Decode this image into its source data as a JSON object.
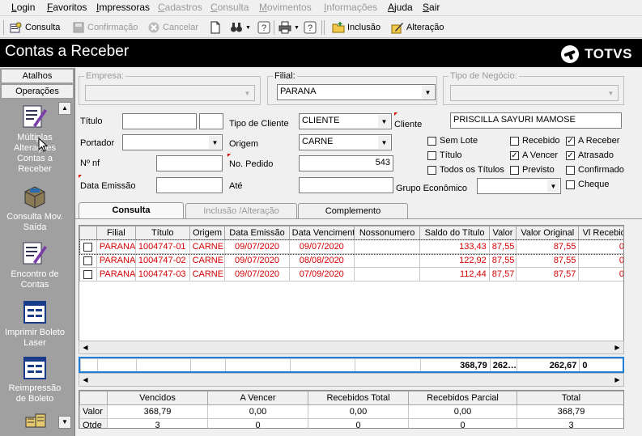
{
  "menu": {
    "items": [
      {
        "label": "Login"
      },
      {
        "label": "Favoritos"
      },
      {
        "label": "Impressoras"
      },
      {
        "label": "Cadastros"
      },
      {
        "label": "Consulta"
      },
      {
        "label": "Movimentos"
      },
      {
        "label": "Informações"
      },
      {
        "label": "Ajuda"
      },
      {
        "label": "Sair"
      }
    ]
  },
  "toolbar": {
    "consulta": "Consulta",
    "confirmacao": "Confirmação",
    "cancelar": "Cancelar",
    "inclusao": "Inclusão",
    "alteracao": "Alteração"
  },
  "header": {
    "title": "Contas a Receber",
    "brand": "TOTVS"
  },
  "sidebar": {
    "atalhos": "Atalhos",
    "operacoes": "Operações",
    "items": [
      {
        "label": "Múltiplas Alterações Contas a Receber",
        "icon": "document-pen-icon"
      },
      {
        "label": "Consulta Mov. Saída",
        "icon": "box-icon"
      },
      {
        "label": "Encontro de Contas",
        "icon": "document-pen-icon"
      },
      {
        "label": "Imprimir Boleto Laser",
        "icon": "form-icon"
      },
      {
        "label": "Reimpressão de Boleto",
        "icon": "form-icon"
      }
    ]
  },
  "form": {
    "empresa_label": "Empresa:",
    "empresa_value": "",
    "filial_label": "Filial:",
    "filial_value": "PARANA",
    "tipo_negocio_label": "Tipo de Negócio:",
    "tipo_negocio_value": "",
    "titulo_label": "Título",
    "titulo_value": "",
    "titulo_seq_value": "",
    "tipo_cliente_label": "Tipo de Cliente",
    "tipo_cliente_value": "CLIENTE",
    "cliente_label": "Cliente",
    "cliente_value": "PRISCILLA SAYURI MAMOSE",
    "portador_label": "Portador",
    "portador_value": "",
    "origem_label": "Origem",
    "origem_value": "CARNE",
    "nf_label": "Nº nf",
    "nf_value": "",
    "pedido_label": "No. Pedido",
    "pedido_value": "543",
    "data_emissao_label": "Data Emissão",
    "data_emissao_value": "",
    "ate_label": "Até",
    "ate_value": "",
    "grupo_label": "Grupo Econômico",
    "grupo_value": ""
  },
  "checkboxes": [
    {
      "label": "Sem Lote",
      "checked": false
    },
    {
      "label": "Título",
      "checked": false
    },
    {
      "label": "Todos os Títulos",
      "checked": false
    },
    {
      "label": "Recebido",
      "checked": false
    },
    {
      "label": "A Vencer",
      "checked": true
    },
    {
      "label": "Previsto",
      "checked": false
    },
    {
      "label": "A Receber",
      "checked": true
    },
    {
      "label": "Atrasado",
      "checked": true
    },
    {
      "label": "Confirmado",
      "checked": false
    },
    {
      "label": "Cheque",
      "checked": false
    }
  ],
  "tabs": [
    {
      "label": "Consulta"
    },
    {
      "label": "Inclusão /Alteração"
    },
    {
      "label": "Complemento"
    }
  ],
  "grid": {
    "columns": [
      "Filial",
      "Título",
      "Origem",
      "Data Emissão",
      "Data Vencimento",
      "Nossonumero",
      "Saldo do Título",
      "Valor",
      "Valor Original",
      "Vl Recebid"
    ],
    "rows": [
      [
        "PARANA",
        "1004747-01",
        "CARNE",
        "09/07/2020",
        "09/07/2020",
        "",
        "133,43",
        "87,55",
        "87,55",
        "0,"
      ],
      [
        "PARANA",
        "1004747-02",
        "CARNE",
        "09/07/2020",
        "08/08/2020",
        "",
        "122,92",
        "87,55",
        "87,55",
        "0,"
      ],
      [
        "PARANA",
        "1004747-03",
        "CARNE",
        "09/07/2020",
        "07/09/2020",
        "",
        "112,44",
        "87,57",
        "87,57",
        "0,"
      ]
    ],
    "totals": {
      "saldo": "368,79",
      "valor": "262…",
      "valor_original": "262,67",
      "vl_recebido": "0"
    }
  },
  "summary": {
    "headers": [
      "Vencidos",
      "A Vencer",
      "Recebidos Total",
      "Recebidos Parcial",
      "Total"
    ],
    "rows": [
      {
        "label": "Valor",
        "values": [
          "368,79",
          "0,00",
          "0,00",
          "0,00",
          "368,79"
        ]
      },
      {
        "label": "Qtde",
        "values": [
          "3",
          "0",
          "0",
          "0",
          "3"
        ]
      }
    ]
  },
  "colors": {
    "data_text": "#d40000",
    "title_bg": "#000000",
    "sidebar_bg": "#a0a0a0"
  }
}
